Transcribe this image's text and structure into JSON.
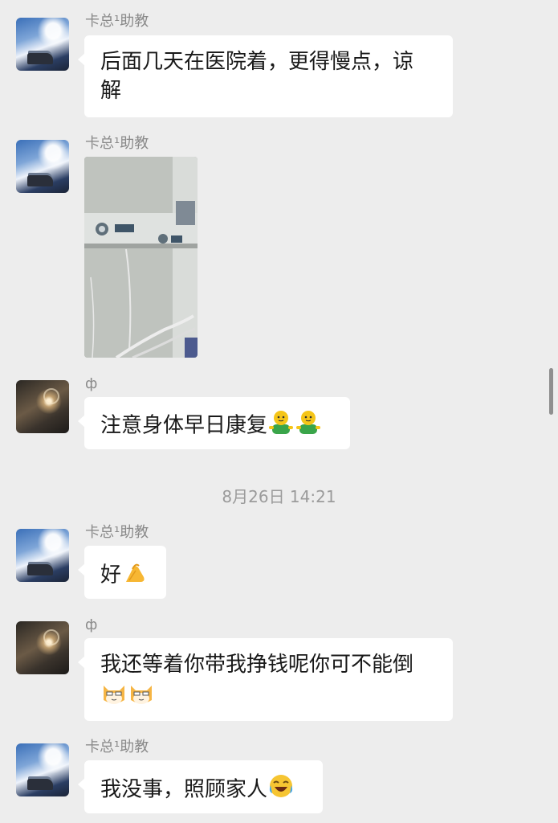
{
  "messages": [
    {
      "sender": "卡总¹助教",
      "text": "后面几天在医院着，更得慢点，谅",
      "text2": "解"
    },
    {
      "sender": "卡总¹助教"
    },
    {
      "sender": "ф",
      "text": "注意身体早日康复"
    },
    {
      "sender": "卡总¹助教",
      "text": "好"
    },
    {
      "sender": "ф",
      "text": "我还等着你带我挣钱呢你可不能倒"
    },
    {
      "sender": "卡总¹助教",
      "text": "我没事，照顾家人"
    }
  ],
  "timestamp": "8月26日 14:21",
  "icons": {
    "avatar_a": "mountain-avatar",
    "avatar_b": "lamp-avatar",
    "photo": "hospital-bed-photo",
    "emoji_man": "green-shirt-person-emoji",
    "emoji_palm": "pinched-hand-emoji",
    "emoji_cat": "cat-face-emoji",
    "emoji_cry": "crying-laughing-emoji"
  },
  "colors": {
    "background": "#ededed",
    "bubble": "#ffffff",
    "name": "#8a8a8a"
  }
}
